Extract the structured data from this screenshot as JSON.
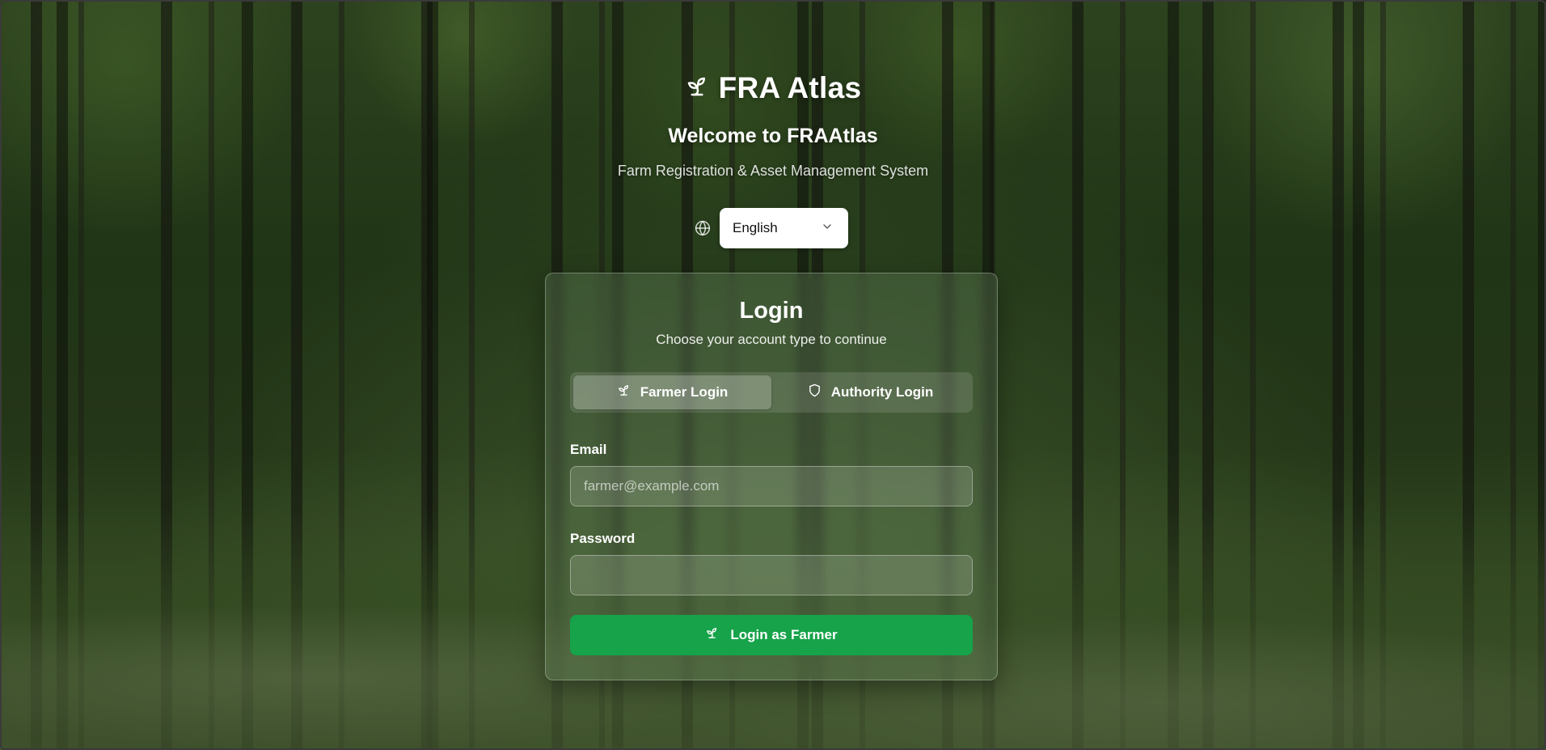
{
  "brand": {
    "title": "FRA Atlas",
    "icon": "sprout-icon"
  },
  "header": {
    "welcome": "Welcome to FRAAtlas",
    "tagline": "Farm Registration & Asset Management System"
  },
  "language": {
    "icon": "globe-icon",
    "selected": "English"
  },
  "login": {
    "title": "Login",
    "subtitle": "Choose your account type to continue",
    "tabs": [
      {
        "label": "Farmer Login",
        "icon": "sprout-icon",
        "active": true
      },
      {
        "label": "Authority Login",
        "icon": "shield-icon",
        "active": false
      }
    ],
    "email": {
      "label": "Email",
      "placeholder": "farmer@example.com",
      "value": ""
    },
    "password": {
      "label": "Password",
      "placeholder": "",
      "value": ""
    },
    "submit_label": "Login as Farmer"
  },
  "colors": {
    "primary_green": "#16a34a",
    "text": "#ffffff"
  }
}
